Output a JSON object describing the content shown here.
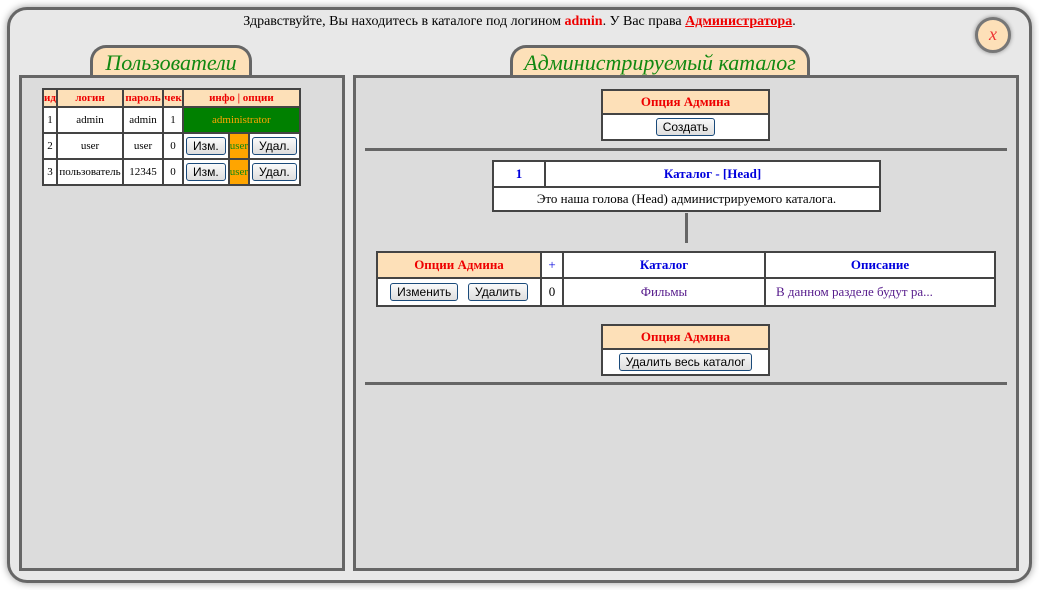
{
  "greeting": {
    "prefix": "Здравствуйте, Вы находитесь в каталоге под логином ",
    "login": "admin",
    "middle": ". У Вас права ",
    "rights": "Администратора",
    "suffix": "."
  },
  "close_label": "x",
  "users_tab": "Пользователи",
  "catalog_tab": "Администрируемый каталог",
  "users": {
    "headers": [
      "ид",
      "логин",
      "пароль",
      "чек",
      "инфо | опции"
    ],
    "rows": [
      {
        "id": "1",
        "login": "admin",
        "password": "admin",
        "check": "1",
        "info": "administrator"
      },
      {
        "id": "2",
        "login": "user",
        "password": "user",
        "check": "0",
        "edit": "Изм.",
        "role": "user",
        "delete": "Удал."
      },
      {
        "id": "3",
        "login": "пользователь",
        "password": "12345",
        "check": "0",
        "edit": "Изм.",
        "role": "user",
        "delete": "Удал."
      }
    ]
  },
  "create_box": {
    "header": "Опция Админа",
    "button": "Создать"
  },
  "head": {
    "num": "1",
    "title": "Каталог - [Head]",
    "desc": "Это наша голова (Head) администрируемого каталога."
  },
  "children": {
    "headers": [
      "Опции Админа",
      "+",
      "Каталог",
      "Описание"
    ],
    "rows": [
      {
        "edit": "Изменить",
        "delete": "Удалить",
        "count": "0",
        "name": "Фильмы",
        "desc": "В данном разделе будут ра..."
      }
    ]
  },
  "delete_box": {
    "header": "Опция Админа",
    "button": "Удалить весь каталог"
  },
  "colors": {
    "accent": "#ee0000",
    "tab_bg": "#fde0b8",
    "tab_text": "#118811",
    "admin_cell": "#008000",
    "user_cell": "#ffa500"
  }
}
